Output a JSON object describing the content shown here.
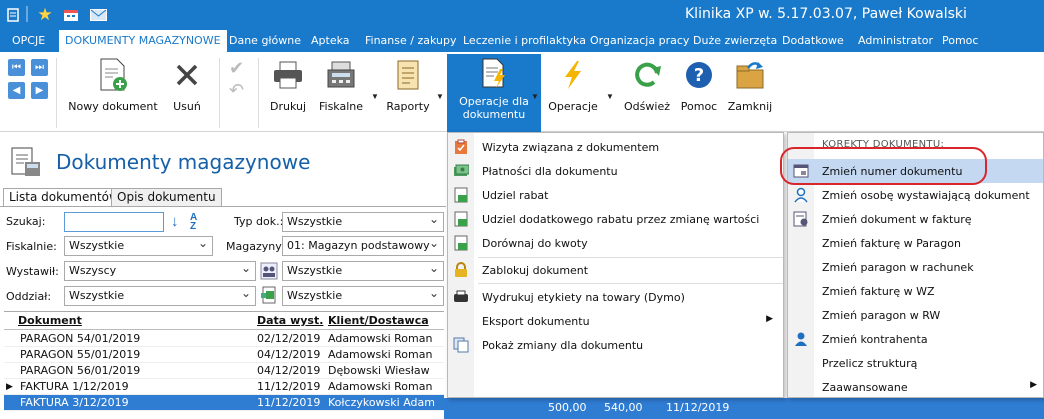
{
  "app": {
    "title": "Klinika XP w. 5.17.03.07, Paweł Kowalski"
  },
  "menubar": [
    "OPCJE",
    "DOKUMENTY MAGAZYNOWE",
    "Dane główne",
    "Apteka",
    "Finanse / zakupy",
    "Leczenie i profilaktyka",
    "Organizacja pracy",
    "Duże zwierzęta",
    "Dodatkowe",
    "Administrator",
    "Pomoc"
  ],
  "ribbon": {
    "new_doc": "Nowy dokument",
    "delete": "Usuń",
    "print": "Drukuj",
    "fiscal": "Fiskalne",
    "reports": "Raporty",
    "doc_ops_1": "Operacje dla",
    "doc_ops_2": "dokumentu",
    "operations": "Operacje",
    "refresh": "Odśwież",
    "help": "Pomoc",
    "close": "Zamknij"
  },
  "page": {
    "title": "Dokumenty magazynowe",
    "tabs": [
      "Lista dokumentów",
      "Opis dokumentu"
    ]
  },
  "filters": {
    "search_label": "Szukaj:",
    "search_value": "",
    "doctype_label": "Typ dok.:",
    "doctype_value": "Wszystkie",
    "fiscal_label": "Fiskalnie:",
    "fiscal_value": "Wszystkie",
    "warehouse_label": "Magazyny:",
    "warehouse_value": "01: Magazyn podstawowy",
    "issuer_label": "Wystawił:",
    "issuer_value": "Wszyscy",
    "issuer2_value": "Wszystkie",
    "branch_label": "Oddział:",
    "branch_value": "Wszystkie",
    "branch2_value": "Wszystkie"
  },
  "grid": {
    "headers": [
      "Dokument",
      "Data wyst.",
      "Klient/Dostawca"
    ],
    "rows": [
      {
        "doc": "PARAGON 54/01/2019",
        "date": "02/12/2019",
        "client": "Adamowski Roman"
      },
      {
        "doc": "PARAGON 55/01/2019",
        "date": "04/12/2019",
        "client": "Adamowski Roman"
      },
      {
        "doc": "PARAGON 56/01/2019",
        "date": "04/12/2019",
        "client": "Dębowski Wiesław"
      },
      {
        "doc": "FAKTURA 1/12/2019",
        "date": "11/12/2019",
        "client": "Adamowski Roman"
      },
      {
        "doc": "FAKTURA 3/12/2019",
        "date": "11/12/2019",
        "client": "Kołczykowski Adam"
      }
    ],
    "selected_row_extra": [
      "500,00",
      "540,00",
      "11/12/2019"
    ]
  },
  "menu1": [
    {
      "label": "Wizyta związana z dokumentem",
      "icon": "clipboard-icon"
    },
    {
      "label": "Płatności dla dokumentu",
      "icon": "money-icon"
    },
    {
      "label": "Udziel rabat",
      "icon": "discount-icon"
    },
    {
      "label": "Udziel dodatkowego rabatu przez zmianę wartości",
      "icon": "discount-icon"
    },
    {
      "label": "Dorównaj do kwoty",
      "icon": "discount-icon"
    },
    {
      "label": "Zablokuj dokument",
      "icon": "lock-icon"
    },
    {
      "label": "Wydrukuj etykiety na towary (Dymo)",
      "icon": "label-printer-icon"
    },
    {
      "label": "Eksport dokumentu",
      "icon": ""
    },
    {
      "label": "Pokaż zmiany dla dokumentu",
      "icon": "copy-icon"
    }
  ],
  "menu2": {
    "header": "KOREKTY DOKUMENTU:",
    "items": [
      {
        "label": "Zmień numer dokumentu",
        "icon": "doc-edit-icon"
      },
      {
        "label": "Zmień osobę wystawiającą dokument",
        "icon": "user-icon"
      },
      {
        "label": "Zmień dokument w fakturę",
        "icon": "doc-gear-icon"
      },
      {
        "label": "Zmień fakturę w Paragon",
        "icon": ""
      },
      {
        "label": "Zmień paragon w rachunek",
        "icon": ""
      },
      {
        "label": "Zmień fakturę w WZ",
        "icon": ""
      },
      {
        "label": "Zmień paragon w RW",
        "icon": ""
      },
      {
        "label": "Zmień kontrahenta",
        "icon": "person-icon"
      },
      {
        "label": "Przelicz strukturą",
        "icon": ""
      },
      {
        "label": "Zaawansowane",
        "icon": ""
      }
    ]
  },
  "colors": {
    "accent": "#1979ca",
    "highlight": "#c4d8f2",
    "annotation": "#d9262c"
  }
}
